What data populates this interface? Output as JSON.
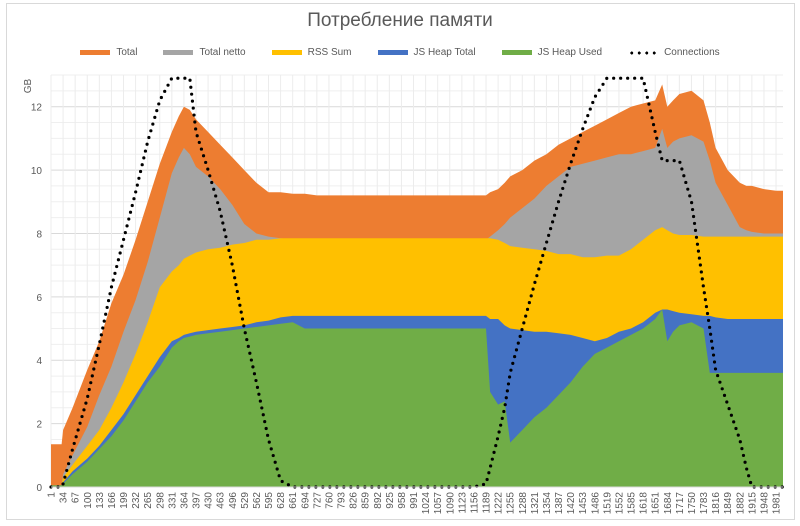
{
  "chart_data": {
    "type": "area",
    "stacked": false,
    "title": "Потребление памяти",
    "xlabel": "",
    "ylabel": "GB",
    "ylim": [
      0,
      13
    ],
    "yticks": [
      0,
      2,
      4,
      6,
      8,
      10,
      12
    ],
    "xlim": [
      1,
      2000
    ],
    "grid": true,
    "legend_position": "top",
    "xtick_labels": [
      "1",
      "34",
      "67",
      "100",
      "133",
      "166",
      "199",
      "232",
      "265",
      "298",
      "331",
      "364",
      "397",
      "430",
      "463",
      "496",
      "529",
      "562",
      "595",
      "628",
      "661",
      "694",
      "727",
      "760",
      "793",
      "826",
      "859",
      "892",
      "925",
      "958",
      "991",
      "1024",
      "1057",
      "1090",
      "1123",
      "1156",
      "1189",
      "1222",
      "1255",
      "1288",
      "1321",
      "1354",
      "1387",
      "1420",
      "1453",
      "1486",
      "1519",
      "1552",
      "1585",
      "1618",
      "1651",
      "1684",
      "1717",
      "1750",
      "1783",
      "1816",
      "1849",
      "1882",
      "1915",
      "1948",
      "1981"
    ],
    "x": [
      1,
      30,
      34,
      60,
      100,
      133,
      166,
      199,
      232,
      265,
      298,
      331,
      350,
      364,
      380,
      397,
      430,
      463,
      496,
      529,
      562,
      595,
      628,
      661,
      694,
      727,
      760,
      793,
      826,
      892,
      958,
      1024,
      1090,
      1156,
      1189,
      1200,
      1222,
      1240,
      1255,
      1288,
      1321,
      1354,
      1387,
      1420,
      1453,
      1486,
      1519,
      1552,
      1585,
      1618,
      1651,
      1670,
      1684,
      1700,
      1717,
      1750,
      1783,
      1800,
      1816,
      1849,
      1882,
      1900,
      1915,
      1948,
      1981,
      2000
    ],
    "series": [
      {
        "name": "Total",
        "color": "#ED7D31",
        "kind": "area",
        "values": [
          1.35,
          1.35,
          1.8,
          2.5,
          3.7,
          4.6,
          5.8,
          6.7,
          7.8,
          9.0,
          10.2,
          11.2,
          11.7,
          12.0,
          11.9,
          11.6,
          11.2,
          10.8,
          10.4,
          10.0,
          9.6,
          9.3,
          9.3,
          9.25,
          9.25,
          9.2,
          9.2,
          9.2,
          9.2,
          9.2,
          9.2,
          9.2,
          9.2,
          9.2,
          9.2,
          9.3,
          9.4,
          9.6,
          9.8,
          10.0,
          10.3,
          10.5,
          10.8,
          11.0,
          11.2,
          11.4,
          11.6,
          11.8,
          12.0,
          12.1,
          12.2,
          12.7,
          12.0,
          12.2,
          12.4,
          12.5,
          12.2,
          11.5,
          10.7,
          10.0,
          9.6,
          9.5,
          9.5,
          9.4,
          9.35,
          9.35
        ]
      },
      {
        "name": "Total netto",
        "color": "#A5A5A5",
        "kind": "area",
        "values": [
          0.05,
          0.05,
          0.4,
          1.0,
          1.9,
          2.9,
          3.8,
          4.9,
          5.9,
          7.1,
          8.5,
          9.9,
          10.4,
          10.7,
          10.5,
          10.1,
          9.8,
          9.4,
          8.9,
          8.3,
          8.0,
          7.9,
          7.85,
          7.8,
          7.8,
          7.8,
          7.8,
          7.8,
          7.8,
          7.8,
          7.8,
          7.8,
          7.8,
          7.8,
          7.8,
          7.9,
          8.1,
          8.3,
          8.5,
          8.8,
          9.1,
          9.5,
          9.8,
          10.1,
          10.2,
          10.3,
          10.4,
          10.5,
          10.5,
          10.6,
          10.7,
          11.3,
          10.7,
          10.9,
          11.0,
          11.1,
          10.9,
          10.3,
          9.6,
          8.9,
          8.2,
          8.1,
          8.05,
          8.0,
          8.0,
          8.0
        ]
      },
      {
        "name": "RSS Sum",
        "color": "#FFC000",
        "kind": "area",
        "values": [
          0.05,
          0.05,
          0.3,
          0.7,
          1.3,
          1.8,
          2.5,
          3.3,
          4.2,
          5.2,
          6.3,
          6.8,
          7.0,
          7.2,
          7.3,
          7.4,
          7.5,
          7.55,
          7.65,
          7.7,
          7.8,
          7.8,
          7.85,
          7.85,
          7.85,
          7.85,
          7.85,
          7.85,
          7.85,
          7.85,
          7.85,
          7.85,
          7.85,
          7.85,
          7.85,
          7.85,
          7.8,
          7.7,
          7.6,
          7.55,
          7.5,
          7.45,
          7.35,
          7.35,
          7.25,
          7.25,
          7.3,
          7.3,
          7.5,
          7.8,
          8.1,
          8.2,
          8.1,
          8.0,
          7.95,
          7.95,
          7.9,
          7.9,
          7.9,
          7.9,
          7.9,
          7.9,
          7.9,
          7.9,
          7.9,
          7.9
        ]
      },
      {
        "name": "JS Heap Total",
        "color": "#4472C4",
        "kind": "area",
        "values": [
          0.05,
          0.05,
          0.15,
          0.5,
          0.9,
          1.3,
          1.8,
          2.3,
          2.9,
          3.5,
          4.1,
          4.6,
          4.7,
          4.8,
          4.85,
          4.9,
          4.95,
          5.0,
          5.05,
          5.1,
          5.2,
          5.25,
          5.35,
          5.4,
          5.4,
          5.4,
          5.4,
          5.4,
          5.4,
          5.4,
          5.4,
          5.4,
          5.4,
          5.4,
          5.4,
          5.3,
          5.3,
          5.1,
          5.0,
          4.95,
          4.9,
          4.9,
          4.85,
          4.8,
          4.7,
          4.6,
          4.7,
          4.9,
          5.0,
          5.2,
          5.5,
          5.6,
          5.6,
          5.55,
          5.5,
          5.45,
          5.4,
          5.4,
          5.35,
          5.3,
          5.3,
          5.3,
          5.3,
          5.3,
          5.3,
          5.3
        ]
      },
      {
        "name": "JS Heap Used",
        "color": "#70AD47",
        "kind": "area",
        "values": [
          0.05,
          0.05,
          0.1,
          0.4,
          0.8,
          1.2,
          1.6,
          2.1,
          2.7,
          3.3,
          3.8,
          4.4,
          4.6,
          4.7,
          4.75,
          4.8,
          4.85,
          4.9,
          4.95,
          5.0,
          5.05,
          5.1,
          5.15,
          5.2,
          5.0,
          5.0,
          5.0,
          5.0,
          5.0,
          5.0,
          5.0,
          5.0,
          5.0,
          5.0,
          5.0,
          3.0,
          2.6,
          2.7,
          1.4,
          1.8,
          2.2,
          2.5,
          2.9,
          3.3,
          3.8,
          4.2,
          4.4,
          4.6,
          4.8,
          5.0,
          5.3,
          5.6,
          4.6,
          4.9,
          5.1,
          5.2,
          5.0,
          3.6,
          3.6,
          3.6,
          3.6,
          3.6,
          3.6,
          3.6,
          3.6,
          3.6
        ]
      },
      {
        "name": "Connections",
        "color": "#000000",
        "kind": "line-dotted",
        "values": [
          0,
          0,
          0.1,
          1.2,
          2.8,
          4.5,
          6.3,
          7.8,
          9.3,
          10.9,
          12.2,
          12.9,
          12.9,
          12.9,
          12.9,
          11.2,
          10.0,
          8.7,
          7.0,
          5.0,
          3.3,
          1.5,
          0.2,
          0,
          0,
          0,
          0,
          0,
          0,
          0,
          0,
          0,
          0,
          0,
          0.1,
          0.6,
          1.6,
          2.5,
          3.6,
          5.0,
          6.4,
          7.7,
          9.0,
          10.2,
          11.3,
          12.3,
          12.9,
          12.9,
          12.9,
          12.9,
          11.2,
          10.3,
          10.3,
          10.3,
          10.3,
          9.0,
          6.3,
          5.0,
          3.7,
          2.6,
          1.5,
          0.6,
          0,
          0,
          0,
          0
        ]
      }
    ]
  }
}
